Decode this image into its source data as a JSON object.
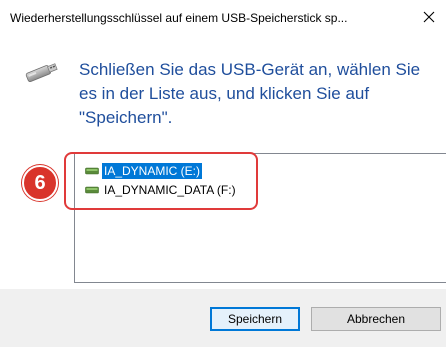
{
  "window": {
    "title": "Wiederherstellungsschlüssel auf einem USB-Speicherstick sp...",
    "close_icon": "close-icon"
  },
  "instruction": {
    "icon": "usb-drive-icon",
    "text": "Schließen Sie das USB-Gerät an, wählen Sie es in der Liste aus, und klicken Sie auf \"Speichern\"."
  },
  "drives": {
    "items": [
      {
        "label": "IA_DYNAMIC (E:)",
        "selected": true,
        "icon": "drive-icon"
      },
      {
        "label": "IA_DYNAMIC_DATA (F:)",
        "selected": false,
        "icon": "drive-icon"
      }
    ]
  },
  "annotation": {
    "step_number": "6",
    "color": "#d9342b"
  },
  "footer": {
    "save_label": "Speichern",
    "cancel_label": "Abbrechen"
  },
  "colors": {
    "instruction_text": "#1f4e9c",
    "selection": "#0078d7",
    "highlight": "#e03a3a"
  }
}
